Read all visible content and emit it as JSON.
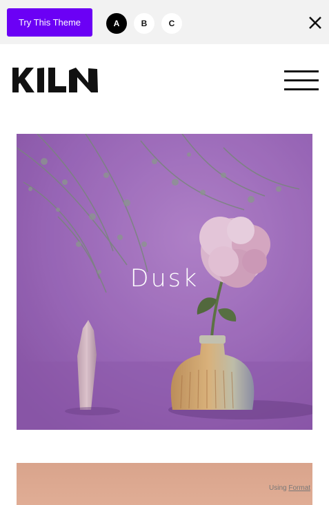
{
  "topbar": {
    "try_label": "Try This Theme",
    "variants": [
      "A",
      "B",
      "C"
    ],
    "active_variant": "A",
    "close_icon": "close-icon"
  },
  "header": {
    "logo_text": "KILN",
    "menu_icon": "hamburger-menu-icon"
  },
  "gallery": {
    "items": [
      {
        "title": "Dusk"
      },
      {
        "title": ""
      }
    ]
  },
  "footer": {
    "credit_prefix": "Using",
    "credit_link": "Format"
  },
  "colors": {
    "accent": "#6b00f5",
    "hero_bg": "#9d6fb8",
    "tile2_bg": "#d9a48c"
  }
}
